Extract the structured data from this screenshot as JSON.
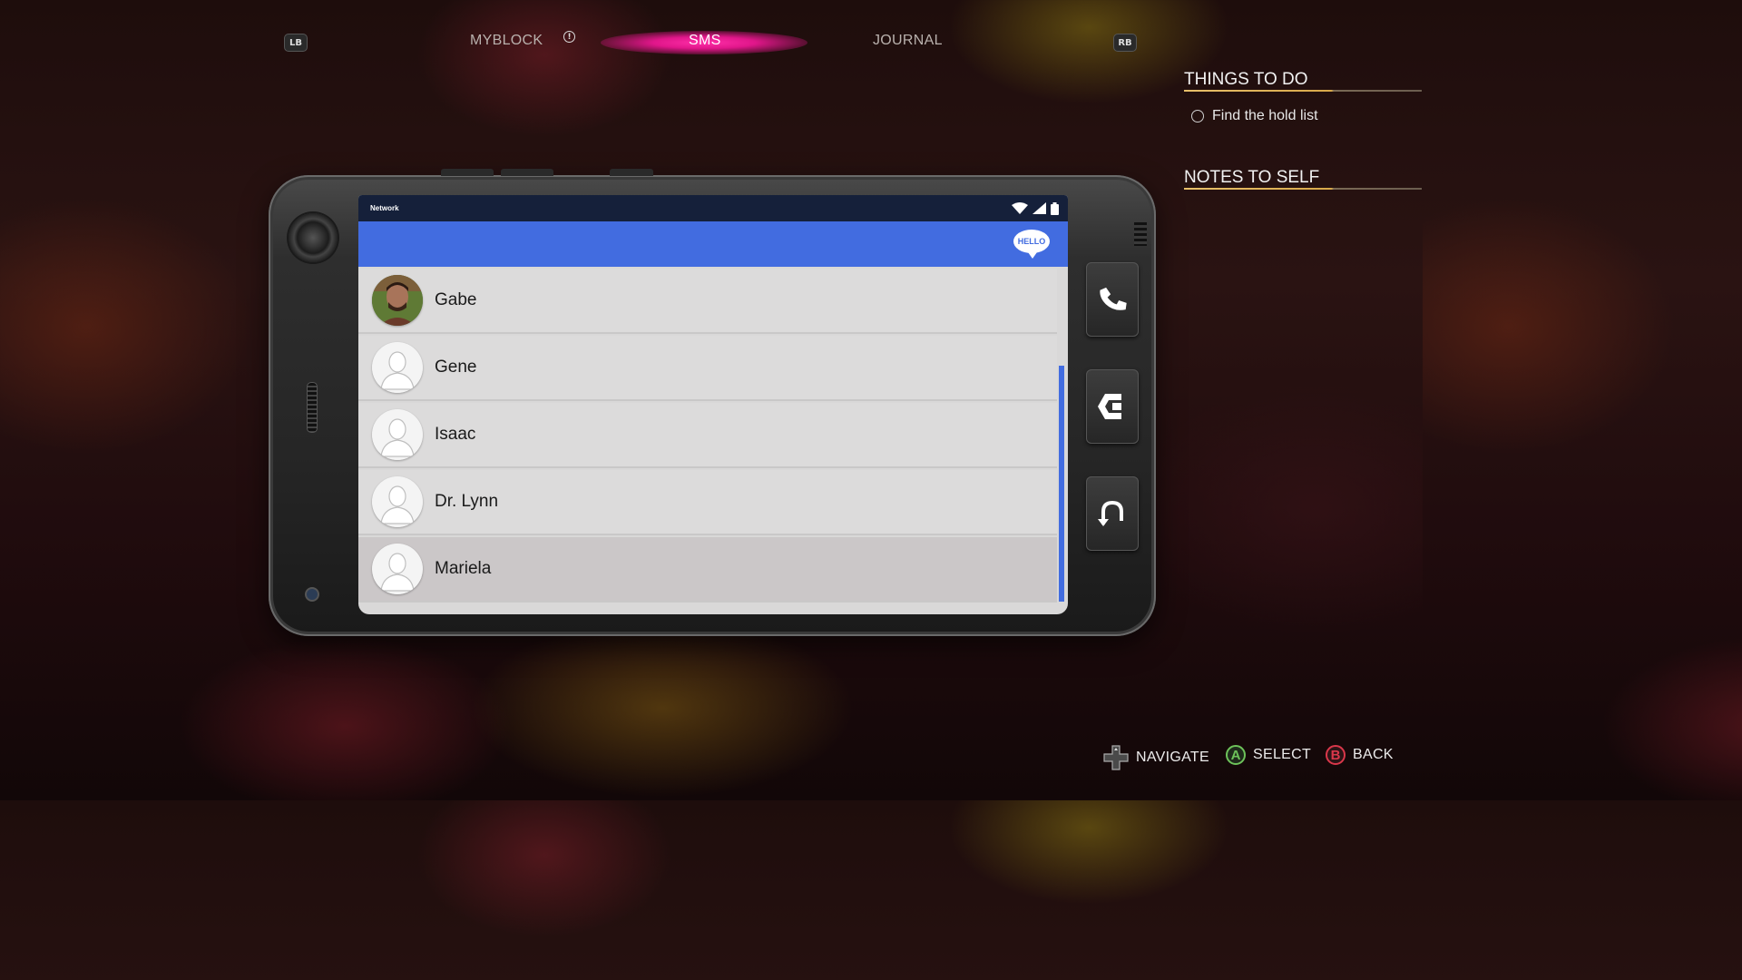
{
  "nav": {
    "lb": "LB",
    "rb": "RB",
    "tabs": [
      {
        "label": "MYBLOCK",
        "active": false,
        "alert": true
      },
      {
        "label": "SMS",
        "active": true,
        "alert": false
      },
      {
        "label": "JOURNAL",
        "active": false,
        "alert": false
      }
    ],
    "alert_glyph": "!"
  },
  "panel": {
    "todo_heading": "THINGS TO DO",
    "todo_items": [
      {
        "label": "Find the hold list",
        "done": false
      }
    ],
    "notes_heading": "NOTES TO SELF"
  },
  "phone": {
    "status": {
      "carrier": "Network",
      "icons": [
        "wifi-icon",
        "signal-icon",
        "battery-icon"
      ]
    },
    "appbar": {
      "badge": "HELLO"
    },
    "contacts": [
      {
        "name": "Gabe",
        "avatar": "photo",
        "selected": false
      },
      {
        "name": "Gene",
        "avatar": "placeholder",
        "selected": false
      },
      {
        "name": "Isaac",
        "avatar": "placeholder",
        "selected": false
      },
      {
        "name": "Dr. Lynn",
        "avatar": "placeholder",
        "selected": false
      },
      {
        "name": "Mariela",
        "avatar": "placeholder",
        "selected": true
      }
    ],
    "side_buttons": [
      "call-icon",
      "message-back-icon",
      "return-icon"
    ]
  },
  "prompts": [
    {
      "glyph": "dpad-icon",
      "label": "NAVIGATE"
    },
    {
      "glyph": "A",
      "label": "SELECT"
    },
    {
      "glyph": "B",
      "label": "BACK"
    }
  ],
  "colors": {
    "accent_blue": "#426ce0",
    "active_tab": "#e0168a",
    "rule_gold": "#d8a94a",
    "a_button": "#6dc25a",
    "b_button": "#d9374a"
  }
}
